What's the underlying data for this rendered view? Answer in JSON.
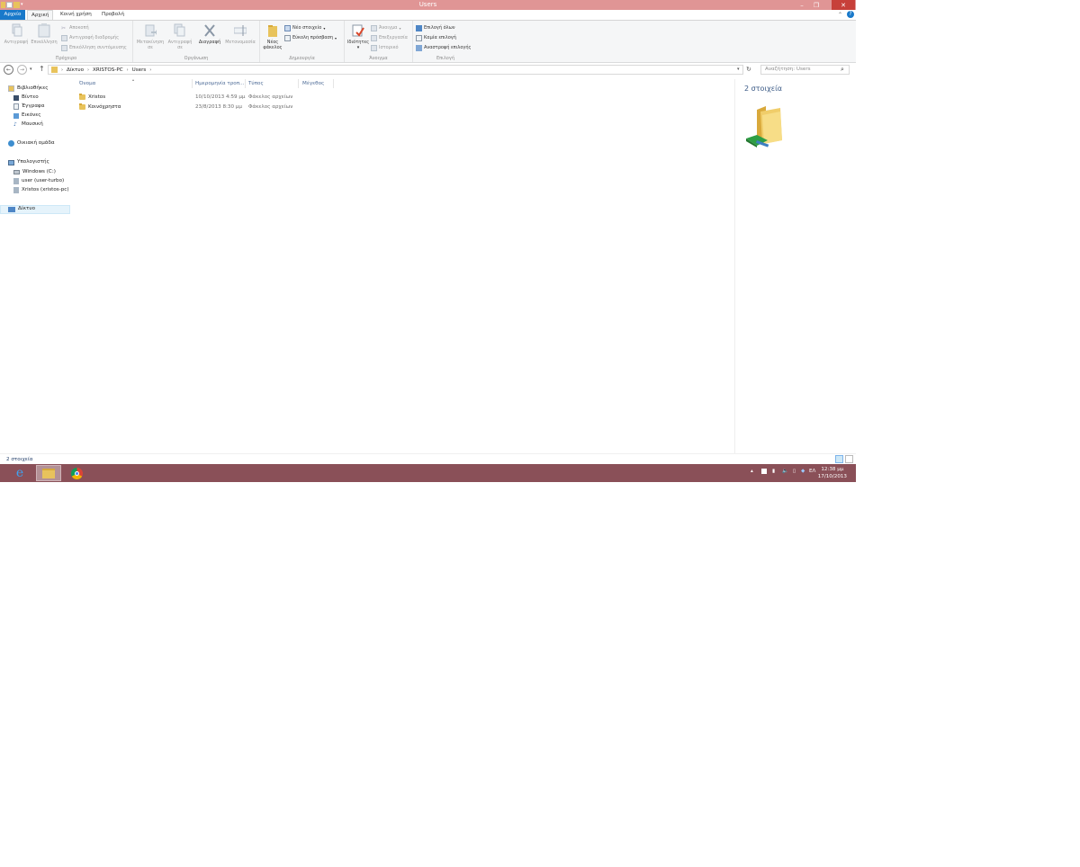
{
  "window": {
    "title": "Users"
  },
  "tabs": [
    "Αρχείο",
    "Αρχική",
    "Κοινή χρήση",
    "Προβολή"
  ],
  "ribbon": {
    "clipboard": {
      "label": "Πρόχειρο",
      "copy": "Αντιγραφή",
      "paste": "Επικόλληση",
      "cut": "Αποκοπή",
      "copy_path": "Αντιγραφή διαδρομής",
      "paste_shortcut": "Επικόλληση συντόμευσης"
    },
    "organize": {
      "label": "Οργάνωση",
      "move_to_1": "Μετακίνηση",
      "move_to_2": "σε",
      "copy_to_1": "Αντιγραφή",
      "copy_to_2": "σε",
      "delete": "Διαγραφή",
      "rename": "Μετονομασία"
    },
    "new": {
      "label": "Δημιουργία",
      "new_folder_1": "Νέος",
      "new_folder_2": "φάκελος",
      "new_item": "Νέο στοιχείο",
      "easy_access": "Εύκολη πρόσβαση"
    },
    "open": {
      "label": "Άνοιγμα",
      "properties": "Ιδιότητες",
      "open": "Άνοιγμα",
      "edit": "Επεξεργασία",
      "history": "Ιστορικό"
    },
    "select": {
      "label": "Επιλογή",
      "select_all": "Επιλογή όλων",
      "select_none": "Καμία επιλογή",
      "invert": "Αναστροφή επιλογής"
    }
  },
  "address": {
    "crumbs": [
      "Δίκτυο",
      "XRISTOS-PC",
      "Users"
    ],
    "search_placeholder": "Αναζήτηση: Users"
  },
  "nav": {
    "libraries": "Βιβλιοθήκες",
    "videos": "Βίντεο",
    "documents": "Έγγραφα",
    "pictures": "Εικόνες",
    "music": "Μουσική",
    "homegroup": "Οικιακή ομάδα",
    "computer": "Υπολογιστής",
    "drive_c": "Windows (C:)",
    "user_turbo": "user (user-turbo)",
    "xristos_pc": "Xristos (xristos-pc)",
    "network": "Δίκτυο"
  },
  "list": {
    "columns": [
      "Όνομα",
      "Ημερομηνία τροπ...",
      "Τύπος",
      "Μέγεθος"
    ],
    "rows": [
      {
        "name": "Xristos",
        "date": "10/10/2013 4:59 μμ",
        "type": "Φάκελος αρχείων"
      },
      {
        "name": "Κοινόχρηστα",
        "date": "23/8/2013 8:30 μμ",
        "type": "Φάκελος αρχείων"
      }
    ]
  },
  "preview": {
    "title": "2 στοιχεία"
  },
  "status": {
    "text": "2 στοιχεία"
  },
  "taskbar": {
    "lang": "ΕΛ",
    "time": "12:38 μμ",
    "date": "17/10/2013"
  },
  "colors": {
    "titlebar": "#e09595",
    "file_tab": "#1979ca",
    "taskbar": "#8a5058",
    "close_button": "#c7403a"
  }
}
